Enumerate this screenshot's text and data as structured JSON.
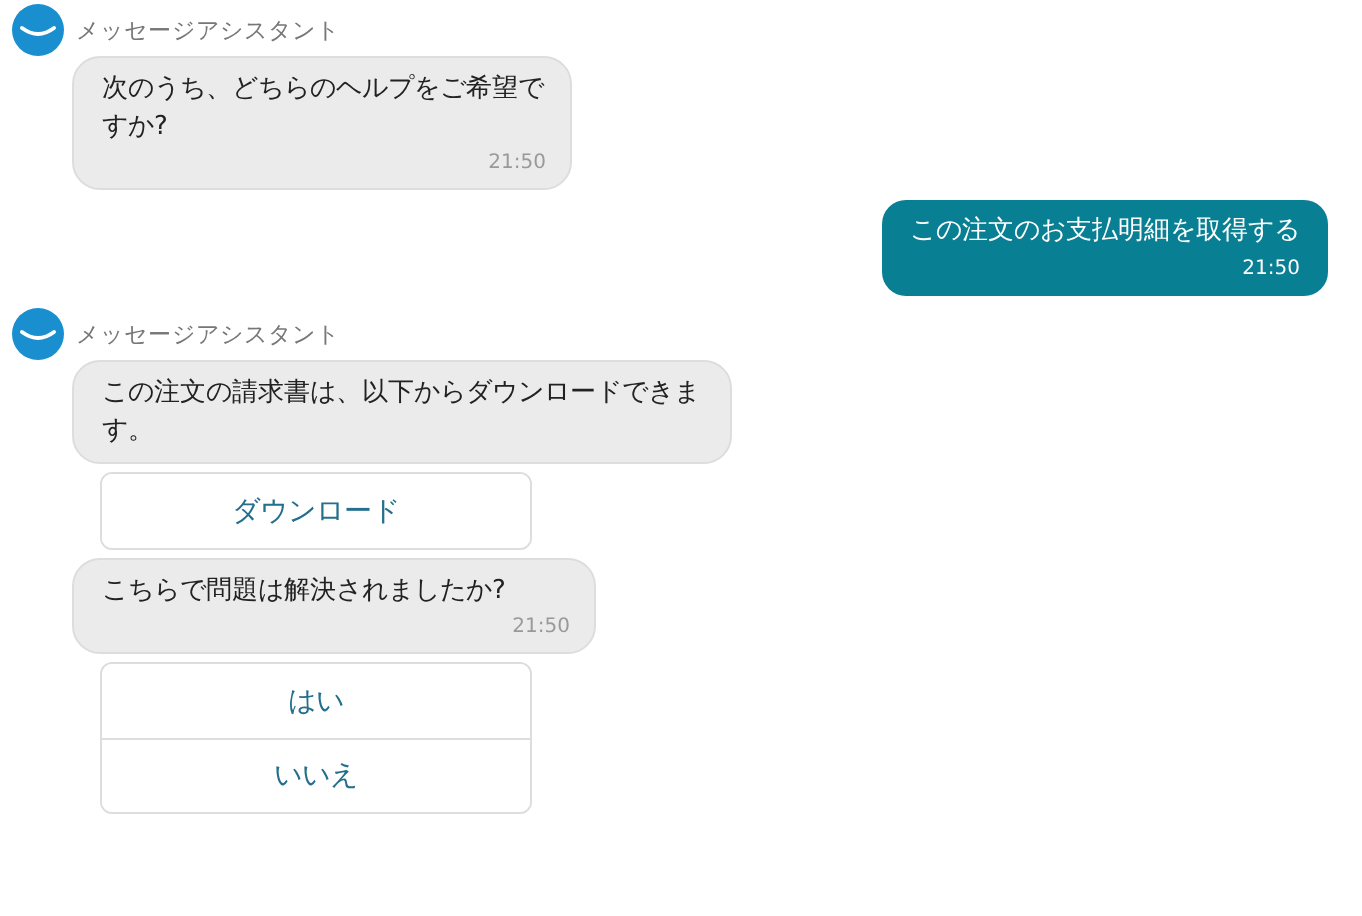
{
  "messages": [
    {
      "kind": "assistant",
      "sender": "メッセージアシスタント",
      "items": [
        {
          "kind": "bubble",
          "text": "次のうち、どちらのヘルプをご希望ですか?",
          "time": "21:50"
        }
      ]
    },
    {
      "kind": "user",
      "text": "この注文のお支払明細を取得する",
      "time": "21:50"
    },
    {
      "kind": "assistant",
      "sender": "メッセージアシスタント",
      "items": [
        {
          "kind": "bubble",
          "text": "この注文の請求書は、以下からダウンロードできます。"
        },
        {
          "kind": "buttons",
          "buttons": [
            "ダウンロード"
          ]
        },
        {
          "kind": "bubble",
          "text": "こちらで問題は解決されましたか?",
          "time": "21:50"
        },
        {
          "kind": "buttons",
          "buttons": [
            "はい",
            "いいえ"
          ]
        }
      ]
    }
  ]
}
